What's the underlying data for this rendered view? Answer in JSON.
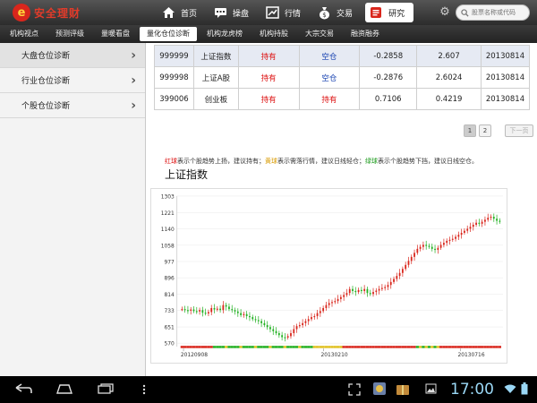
{
  "brand": {
    "name": "安全理财",
    "mark": "e"
  },
  "nav": [
    {
      "label": "首页",
      "icon": "home-icon"
    },
    {
      "label": "操盘",
      "icon": "chat-icon"
    },
    {
      "label": "行情",
      "icon": "chart-icon"
    },
    {
      "label": "交易",
      "icon": "moneybag-icon"
    },
    {
      "label": "研究",
      "icon": "report-icon"
    }
  ],
  "search": {
    "placeholder": "股票名称或代码"
  },
  "subtabs": [
    "机构视点",
    "预测评级",
    "量暖看盘",
    "量化仓位诊断",
    "机构龙虎榜",
    "机构持股",
    "大宗交易",
    "融资融券"
  ],
  "sidebar": [
    {
      "label": "大盘仓位诊断"
    },
    {
      "label": "行业仓位诊断"
    },
    {
      "label": "个股仓位诊断"
    }
  ],
  "table": [
    {
      "code": "999999",
      "name": "上证指数",
      "s1": "持有",
      "s2": "空仓",
      "v1": "-0.2858",
      "v2": "2.607",
      "date": "20130814"
    },
    {
      "code": "999998",
      "name": "上证A股",
      "s1": "持有",
      "s2": "空仓",
      "v1": "-0.2876",
      "v2": "2.6024",
      "date": "20130814"
    },
    {
      "code": "399006",
      "name": "创业板",
      "s1": "持有",
      "s2": "持有",
      "v1": "0.7106",
      "v2": "0.4219",
      "date": "20130814"
    }
  ],
  "pager": {
    "p1": "1",
    "p2": "2",
    "next": "下一页"
  },
  "legend": {
    "red": "红球",
    "red_text": "表示个股趋势上扬，建议持有；",
    "yellow": "黄球",
    "yellow_text": "表示需落行情，建议日线轻仓；",
    "green": "绿球",
    "green_text": "表示个股趋势下挡，建议日线空仓。"
  },
  "chart_title": "上证指数",
  "chart_data": {
    "type": "line",
    "title": "上证指数",
    "ylim": [
      570,
      1303
    ],
    "yticks": [
      570,
      651,
      733,
      814,
      896,
      977,
      1058,
      1140,
      1221,
      1303
    ],
    "xticks": [
      "20120908",
      "20130210",
      "20130716"
    ],
    "series": [
      {
        "values": [
          740,
          735,
          732,
          738,
          730,
          728,
          735,
          722,
          718,
          725,
          745,
          738,
          742,
          735,
          760,
          752,
          740,
          735,
          728,
          720,
          710,
          715,
          705,
          700,
          690,
          685,
          680,
          670,
          660,
          650,
          640,
          630,
          620,
          610,
          600,
          598,
          605,
          620,
          640,
          655,
          660,
          670,
          680,
          690,
          700,
          705,
          720,
          730,
          745,
          760,
          770,
          775,
          780,
          790,
          800,
          810,
          820,
          840,
          830,
          825,
          835,
          830,
          840,
          820,
          815,
          825,
          832,
          840,
          845,
          850,
          860,
          875,
          890,
          905,
          920,
          940,
          960,
          980,
          1000,
          1020,
          1040,
          1050,
          1060,
          1055,
          1050,
          1040,
          1035,
          1045,
          1060,
          1070,
          1080,
          1085,
          1090,
          1100,
          1110,
          1120,
          1130,
          1140,
          1150,
          1160,
          1170,
          1165,
          1175,
          1185,
          1195,
          1200,
          1190,
          1180,
          1175
        ]
      }
    ]
  },
  "sys": {
    "clock": "17:00"
  },
  "colors": {
    "up": "#d9261c",
    "down": "#22b022",
    "neutral": "#e0c020",
    "header_dark": "#2c2c2c"
  }
}
